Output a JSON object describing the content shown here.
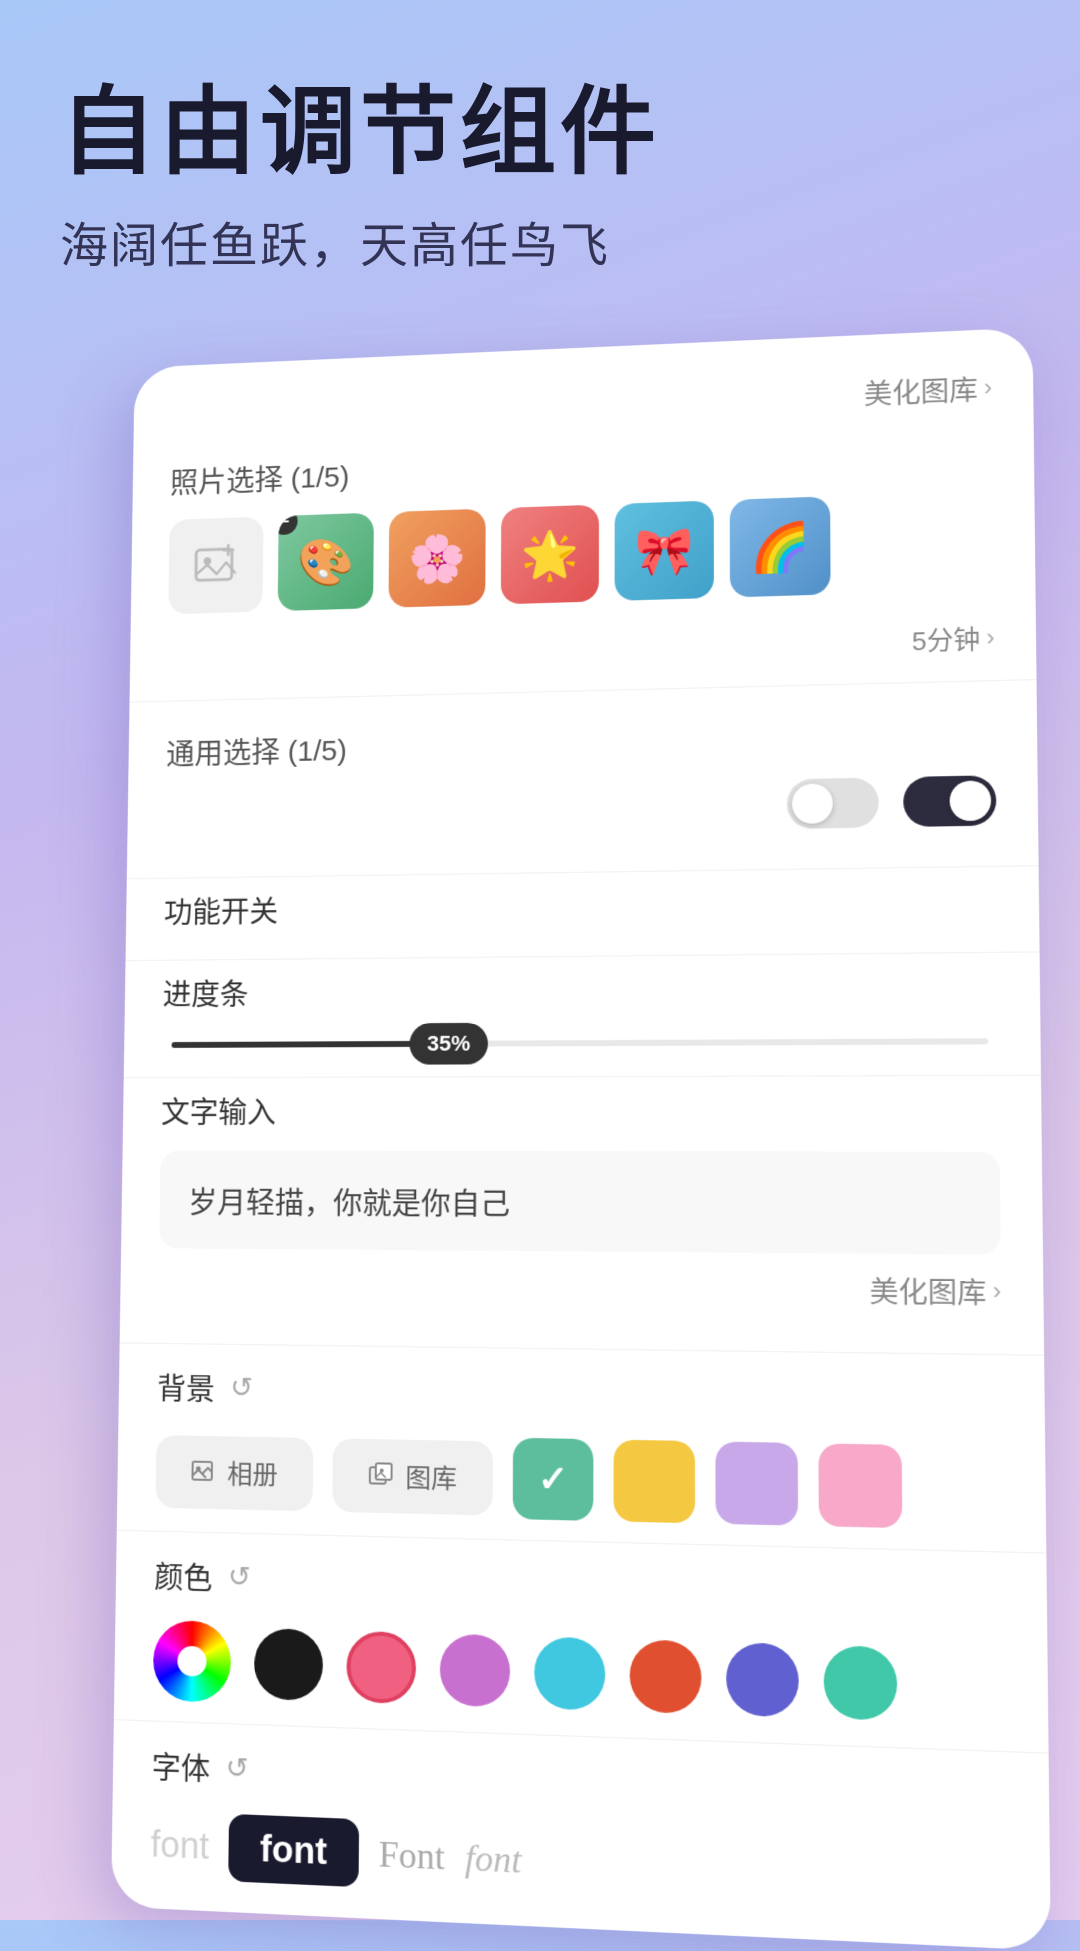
{
  "header": {
    "main_title": "自由调节组件",
    "sub_title": "海阔任鱼跃，天高任鸟飞"
  },
  "top_link": {
    "label": "美化图库",
    "chevron": "›"
  },
  "photo_section": {
    "label": "照片选择 (1/5)",
    "time_label": "5分钟",
    "chevron": "›"
  },
  "general_section": {
    "label": "通用选择 (1/5)"
  },
  "function_switch": {
    "label": "功能开关"
  },
  "progress_section": {
    "label": "进度条",
    "value": "35%"
  },
  "text_input_section": {
    "label": "文字输入",
    "value": "岁月轻描，你就是你自己",
    "beautify_label": "美化图库",
    "chevron": "›"
  },
  "background_section": {
    "label": "背景",
    "album_btn": "相册",
    "gallery_btn": "图库",
    "colors": [
      "#5dbe9e",
      "#f5c842",
      "#c8a8e8",
      "#f8a8c8"
    ]
  },
  "color_section": {
    "label": "颜色",
    "dots": [
      "#1a1a1a",
      "#f06080",
      "#c870d0",
      "#40c8e0",
      "#e05030",
      "#6060d0",
      "#40c8a8"
    ]
  },
  "font_section": {
    "label": "字体",
    "items": [
      {
        "text": "font",
        "style": "normal-faded",
        "label": "font-item-left"
      },
      {
        "text": "font",
        "style": "selected",
        "label": "font-item-center"
      },
      {
        "text": "Font",
        "style": "normal",
        "label": "font-item-right1"
      },
      {
        "text": "font",
        "style": "italic",
        "label": "font-item-right2"
      }
    ]
  }
}
